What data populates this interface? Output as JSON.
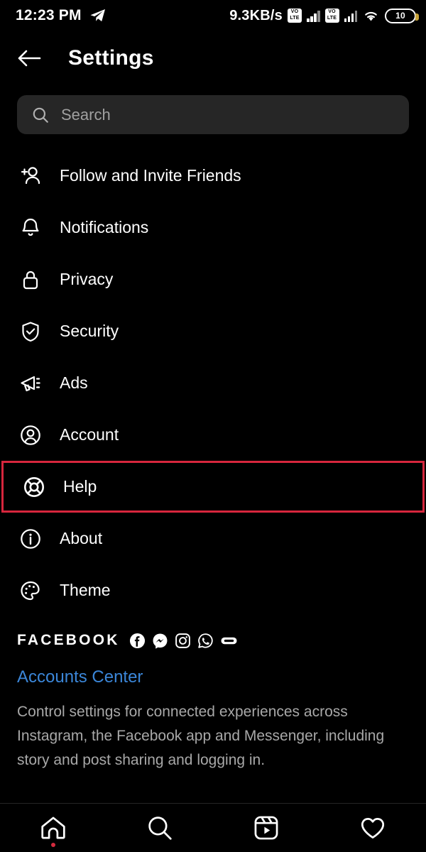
{
  "status_bar": {
    "time": "12:23 PM",
    "app_icon": "telegram-icon",
    "network_speed": "9.3KB/s",
    "volte_label_1": "VO LTE",
    "volte_label_2": "VO LTE",
    "wifi_icon": "wifi-icon",
    "battery_level": "10"
  },
  "header": {
    "back_icon": "back-arrow-icon",
    "title": "Settings"
  },
  "search": {
    "icon": "search-icon",
    "placeholder": "Search",
    "value": ""
  },
  "menu": {
    "items": [
      {
        "label": "Follow and Invite Friends",
        "icon": "person-add-icon",
        "highlighted": false
      },
      {
        "label": "Notifications",
        "icon": "bell-icon",
        "highlighted": false
      },
      {
        "label": "Privacy",
        "icon": "lock-icon",
        "highlighted": false
      },
      {
        "label": "Security",
        "icon": "shield-check-icon",
        "highlighted": false
      },
      {
        "label": "Ads",
        "icon": "megaphone-icon",
        "highlighted": false
      },
      {
        "label": "Account",
        "icon": "account-circle-icon",
        "highlighted": false
      },
      {
        "label": "Help",
        "icon": "lifebuoy-icon",
        "highlighted": true
      },
      {
        "label": "About",
        "icon": "info-circle-icon",
        "highlighted": false
      },
      {
        "label": "Theme",
        "icon": "palette-icon",
        "highlighted": false
      }
    ]
  },
  "facebook_section": {
    "brand_word": "FACEBOOK",
    "brand_icons": [
      "facebook-icon",
      "messenger-icon",
      "instagram-icon",
      "whatsapp-icon",
      "portal-icon"
    ],
    "accounts_center_link": "Accounts Center",
    "description": "Control settings for connected experiences across Instagram, the Facebook app and Messenger, including story and post sharing and logging in."
  },
  "bottom_nav": {
    "items": [
      {
        "icon": "home-icon",
        "badge": true
      },
      {
        "icon": "search-nav-icon",
        "badge": false
      },
      {
        "icon": "reels-icon",
        "badge": false
      },
      {
        "icon": "heart-icon",
        "badge": false
      }
    ]
  },
  "colors": {
    "background": "#000000",
    "search_field": "#262626",
    "highlight_border": "#d7263d",
    "link": "#3b86d8",
    "muted_text": "#a8a8a8",
    "badge": "#d32b3e"
  }
}
